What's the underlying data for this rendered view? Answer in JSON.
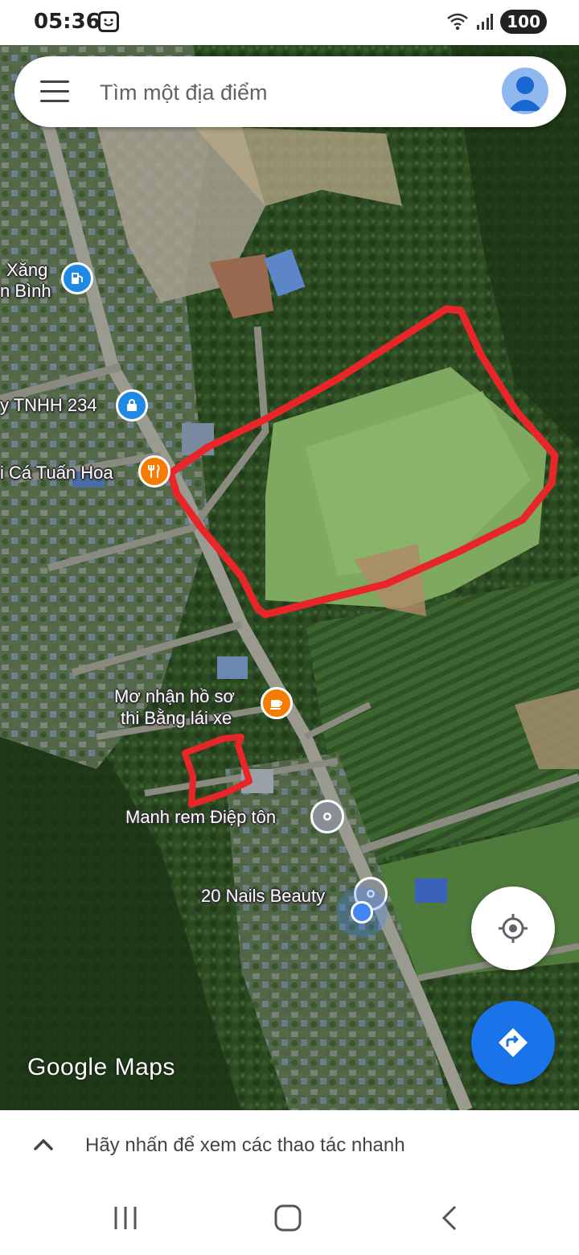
{
  "status_bar": {
    "time": "05:36",
    "battery": "100",
    "icons": [
      "face-icon",
      "wifi-icon",
      "signal-icon",
      "battery-icon"
    ]
  },
  "search": {
    "placeholder": "Tìm một địa điểm"
  },
  "map_labels": {
    "gas_station_line1": "Xăng",
    "gas_station_line2": "n Bình",
    "company": "y TNHH 234",
    "restaurant": "i Cá Tuấn Hoa",
    "license_line1": "Mơ nhận hồ sơ",
    "license_line2": "thi Bằng lái xe",
    "place": "Manh rem Điệp tôn",
    "nails": "20 Nails Beauty"
  },
  "logo": {
    "text": "Google Maps"
  },
  "bottom_sheet": {
    "text": "Hãy nhấn để xem các thao tác nhanh"
  },
  "colors": {
    "annotation_red": "#e8262a",
    "directions_blue": "#1a73e8",
    "restaurant_orange": "#f57c00",
    "poi_blue": "#1e88e5",
    "my_location_blue": "#4285f4"
  }
}
